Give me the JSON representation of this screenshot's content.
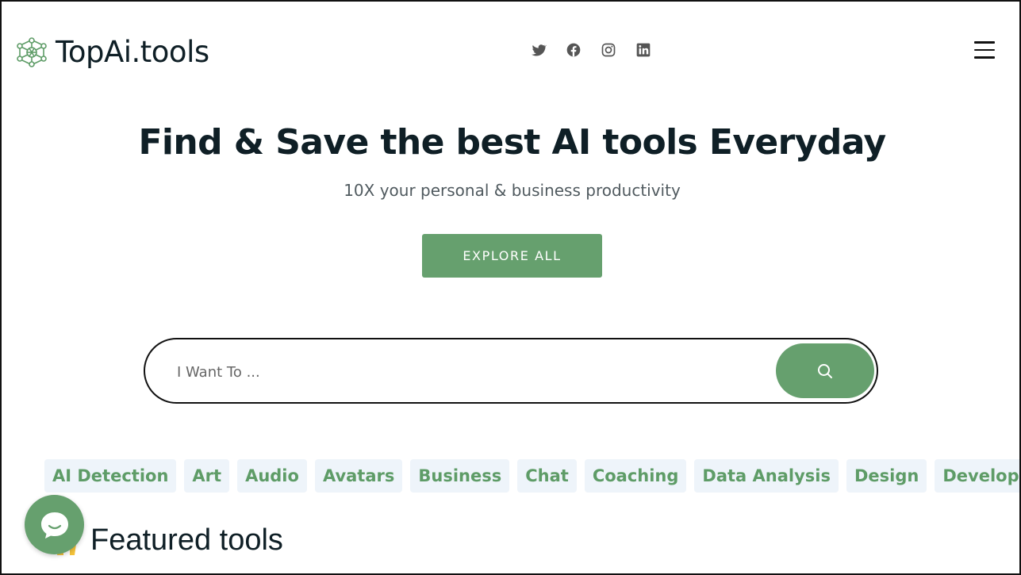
{
  "brand": {
    "name": "TopAi.tools",
    "logo_icon": "network-nodes-icon",
    "accent": "#66a06e"
  },
  "social": [
    {
      "icon": "twitter-icon",
      "name": "Twitter"
    },
    {
      "icon": "facebook-icon",
      "name": "Facebook"
    },
    {
      "icon": "instagram-icon",
      "name": "Instagram"
    },
    {
      "icon": "linkedin-icon",
      "name": "LinkedIn"
    }
  ],
  "menu": {
    "icon": "hamburger-menu-icon"
  },
  "hero": {
    "title": "Find & Save the best AI tools Everyday",
    "subtitle": "10X your personal & business productivity",
    "cta_label": "EXPLORE ALL"
  },
  "search": {
    "placeholder": "I Want To ...",
    "value": "",
    "button_icon": "search-icon"
  },
  "categories": [
    "AI Detection",
    "Art",
    "Audio",
    "Avatars",
    "Business",
    "Chat",
    "Coaching",
    "Data Analysis",
    "Design",
    "Development"
  ],
  "featured": {
    "title": "Featured tools",
    "icon": "featured-hands-icon"
  },
  "chat_widget": {
    "icon": "chat-bubble-icon"
  }
}
